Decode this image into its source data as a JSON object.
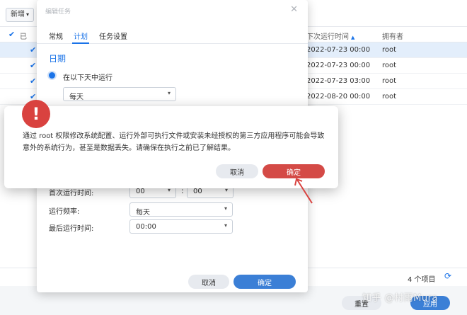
{
  "toolbar": {
    "new_label": "新增",
    "new_caret": "▾"
  },
  "table": {
    "header": {
      "check_icon": "checkmark-icon",
      "partial_col": "已",
      "next_run_col": "下次运行时间",
      "sort_glyph": "▲",
      "owner_col": "拥有者"
    },
    "rows": [
      {
        "next_run": "2022-07-23 00:00",
        "owner": "root",
        "selected": true
      },
      {
        "next_run": "2022-07-23 00:00",
        "owner": "root",
        "selected": false
      },
      {
        "next_run": "2022-07-23 03:00",
        "owner": "root",
        "selected": false
      },
      {
        "next_run": "2022-08-20 00:00",
        "owner": "root",
        "selected": false
      }
    ]
  },
  "footer": {
    "count": "4 个项目",
    "refresh_glyph": "⟳"
  },
  "bottom_buttons": {
    "reset": "重置",
    "apply": "应用"
  },
  "watermark": "知乎 @村雨Mura",
  "edit_dialog": {
    "title": "编辑任务",
    "close_glyph": "✕",
    "tabs": [
      {
        "label": "常规",
        "active": false
      },
      {
        "label": "计划",
        "active": true
      },
      {
        "label": "任务设置",
        "active": false
      }
    ],
    "section_title": "日期",
    "radio_label": "在以下天中运行",
    "day_select": "每天",
    "first_run_label": "首次运行时间:",
    "first_run_hour": "00",
    "first_run_minute": "00",
    "time_colon": ":",
    "frequency_label": "运行频率:",
    "frequency_value": "每天",
    "last_run_label": "最后运行时间:",
    "last_run_value": "00:00",
    "cancel": "取消",
    "ok": "确定",
    "arrow_glyph": "▾"
  },
  "alert": {
    "icon_glyph": "!",
    "message": "通过 root 权限修改系统配置、运行外部可执行文件或安装未经授权的第三方应用程序可能会导致意外的系统行为，甚至是数据丢失。请确保在执行之前已了解结果。",
    "cancel": "取消",
    "ok": "确定"
  },
  "colors": {
    "accent": "#3b7fd6",
    "danger": "#d44a46",
    "annotation": "#d9423f"
  }
}
